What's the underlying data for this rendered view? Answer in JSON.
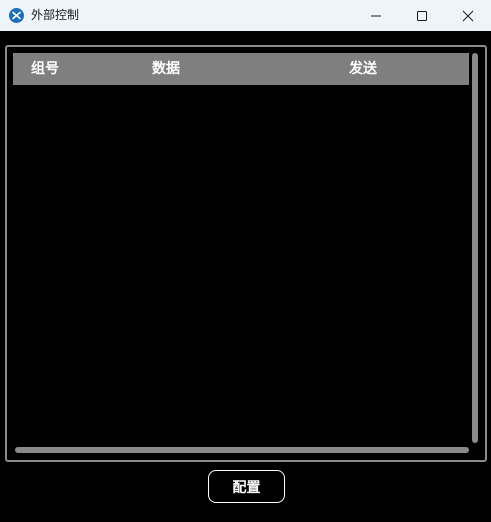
{
  "window": {
    "title": "外部控制",
    "icon": "app-logo-icon",
    "controls": [
      "minimize-icon",
      "maximize-icon",
      "close-icon"
    ]
  },
  "table": {
    "columns": [
      "组号",
      "数据",
      "发送"
    ],
    "rows": []
  },
  "actions": {
    "config_label": "配置"
  },
  "colors": {
    "background": "#000000",
    "titlebar": "#eef5fa",
    "header": "#7f7f7f",
    "border": "#8a8a8a",
    "text": "#ffffff"
  }
}
